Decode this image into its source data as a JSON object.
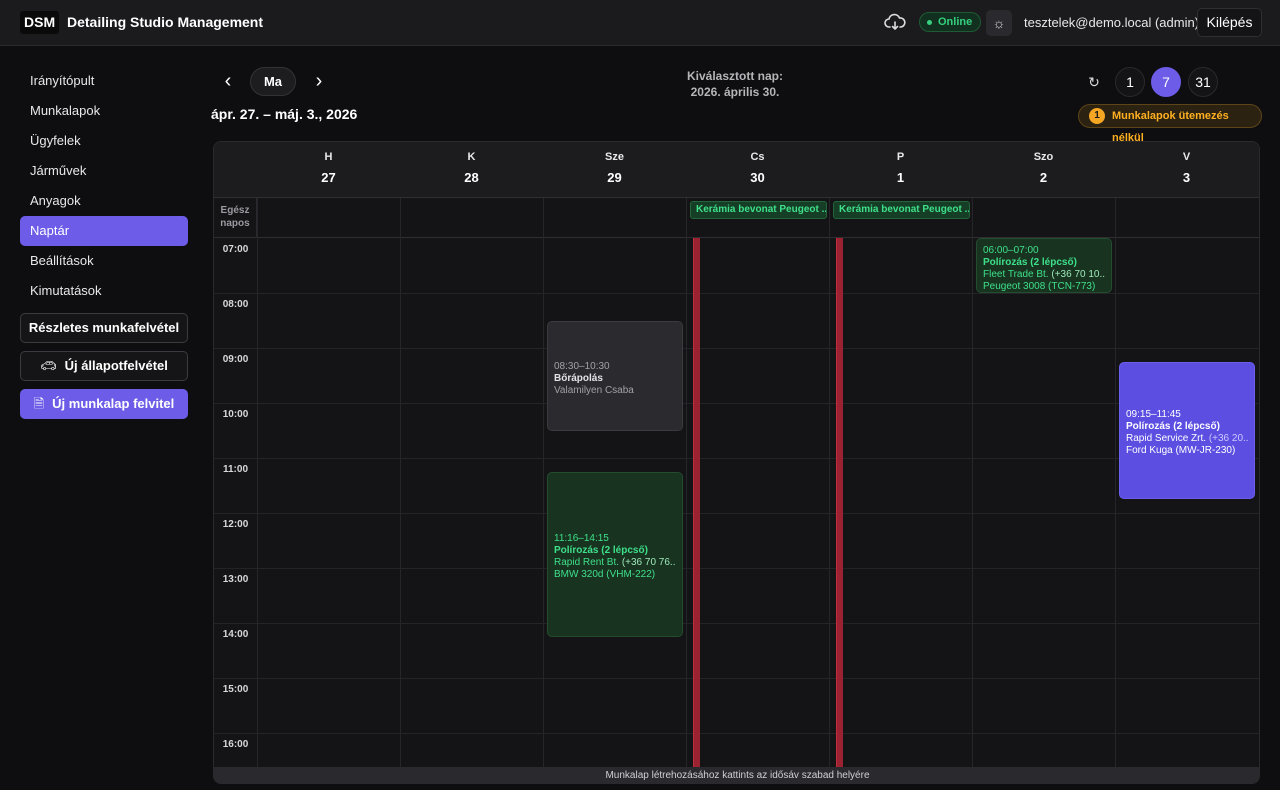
{
  "header": {
    "logo": "DSM",
    "title": "Detailing Studio Management",
    "status": "Online",
    "user": "tesztelek@demo.local (admin)",
    "logout_label": "Kilépés"
  },
  "sidebar": {
    "items": [
      {
        "label": "Irányítópult"
      },
      {
        "label": "Munkalapok"
      },
      {
        "label": "Ügyfelek"
      },
      {
        "label": "Járművek"
      },
      {
        "label": "Anyagok"
      },
      {
        "label": "Naptár"
      },
      {
        "label": "Beállítások"
      },
      {
        "label": "Kimutatások"
      }
    ],
    "btn_detailed": "Részletes munkafelvétel",
    "btn_condition": "Új állapotfelvétel",
    "btn_new_worksheet": "Új munkalap felvitel"
  },
  "toolbar": {
    "today_label": "Ma",
    "range": "ápr. 27. – máj. 3., 2026",
    "selected_label": "Kiválasztott nap:",
    "selected_date": "2026. április 30.",
    "view_1": "1",
    "view_7": "7",
    "view_31": "31",
    "unscheduled_count": "1",
    "unscheduled_label": "Munkalapok ütemezés nélkül"
  },
  "calendar": {
    "days": [
      {
        "name": "H",
        "date": "27"
      },
      {
        "name": "K",
        "date": "28"
      },
      {
        "name": "Sze",
        "date": "29"
      },
      {
        "name": "Cs",
        "date": "30"
      },
      {
        "name": "P",
        "date": "1"
      },
      {
        "name": "Szo",
        "date": "2"
      },
      {
        "name": "V",
        "date": "3"
      }
    ],
    "allday_label_1": "Egész",
    "allday_label_2": "napos",
    "allday_events": [
      {
        "label": "Kerámia bevonat Peugeot ..."
      },
      {
        "label": "Kerámia bevonat Peugeot ..."
      }
    ],
    "hours": [
      "07:00",
      "08:00",
      "09:00",
      "10:00",
      "11:00",
      "12:00",
      "13:00",
      "14:00",
      "15:00",
      "16:00"
    ],
    "events": [
      {
        "time": "06:00–07:00",
        "title": "Polírozás (2 lépcső)",
        "customer": "Fleet Trade Bt.",
        "phone": "(+36 70 10...",
        "car": "Peugeot 3008 (TCN-773)"
      },
      {
        "time": "08:30–10:30",
        "title": "Bőrápolás",
        "customer": "Valamilyen Csaba"
      },
      {
        "time": "11:16–14:15",
        "title": "Polírozás (2 lépcső)",
        "customer": "Rapid Rent Bt.",
        "phone": "(+36 70 76...",
        "car": "BMW 320d (VHM-222)"
      },
      {
        "time": "09:15–11:45",
        "title": "Polírozás (2 lépcső)",
        "customer": "Rapid Service Zrt.",
        "phone": "(+36 20...",
        "car": "Ford Kuga (MW-JR-230)"
      }
    ],
    "footer": "Munkalap létrehozásához kattints az idősáv szabad helyére"
  }
}
